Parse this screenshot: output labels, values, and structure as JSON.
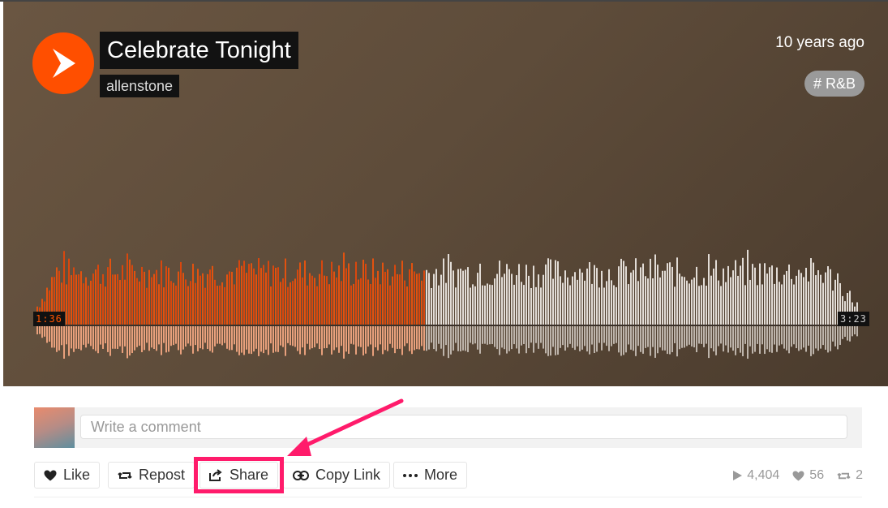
{
  "track": {
    "title": "Celebrate Tonight",
    "artist": "allenstone",
    "posted": "10 years ago",
    "genre": "# R&B"
  },
  "player": {
    "current_time": "1:36",
    "duration": "3:23",
    "progress": 0.473
  },
  "comment": {
    "placeholder": "Write a comment"
  },
  "actions": {
    "like": "Like",
    "repost": "Repost",
    "share": "Share",
    "copy_link": "Copy Link",
    "more": "More"
  },
  "stats": {
    "plays": "4,404",
    "likes": "56",
    "reposts": "2"
  },
  "colors": {
    "accent": "#ff5500",
    "highlight": "#ff1b6b"
  },
  "icons": [
    "play-icon",
    "heart-icon",
    "repost-icon",
    "share-icon",
    "link-icon",
    "more-icon"
  ]
}
